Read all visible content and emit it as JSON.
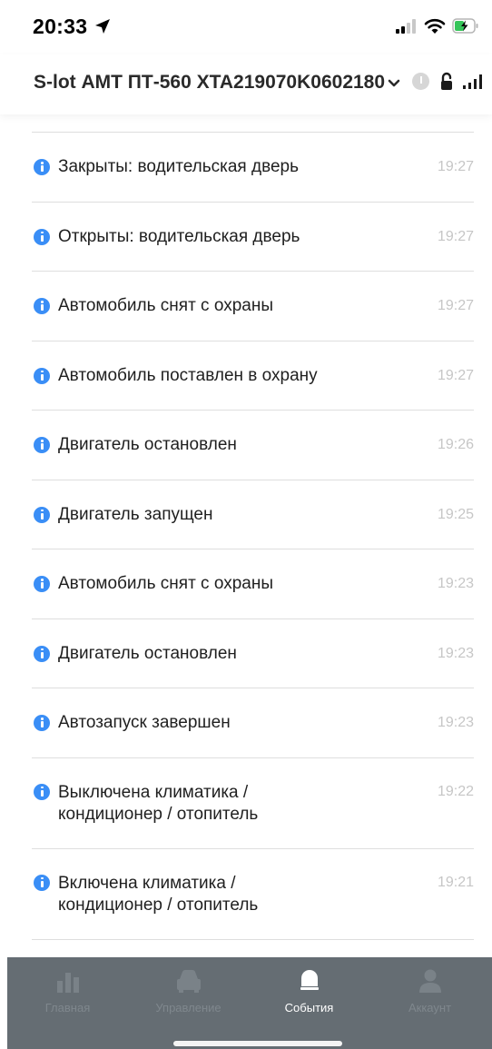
{
  "status_bar": {
    "time": "20:33",
    "icons": [
      "location-arrow-icon",
      "cellular-signal-icon",
      "wifi-icon",
      "battery-charging-icon"
    ]
  },
  "header": {
    "device_title": "S-lot АМТ ПТ-560 XTA219070K0602180",
    "icons": [
      "chevron-down-icon",
      "info-icon",
      "lock-open-icon",
      "signal-icon"
    ]
  },
  "events": [
    {
      "text": "Закрыты: водительская дверь",
      "time": "19:27"
    },
    {
      "text": "Открыты: водительская дверь",
      "time": "19:27"
    },
    {
      "text": "Автомобиль снят с охраны",
      "time": "19:27"
    },
    {
      "text": "Автомобиль поставлен в охрану",
      "time": "19:27"
    },
    {
      "text": "Двигатель остановлен",
      "time": "19:26"
    },
    {
      "text": "Двигатель запущен",
      "time": "19:25"
    },
    {
      "text": "Автомобиль снят с охраны",
      "time": "19:23"
    },
    {
      "text": "Двигатель остановлен",
      "time": "19:23"
    },
    {
      "text": "Автозапуск завершен",
      "time": "19:23"
    },
    {
      "text": "Выключена климатика / кондиционер / отопитель",
      "time": "19:22"
    },
    {
      "text": "Включена климатика / кондиционер / отопитель",
      "time": "19:21"
    }
  ],
  "tabbar": {
    "active_index": 2,
    "tabs": [
      {
        "label": "Главная",
        "icon": "bar-chart-icon"
      },
      {
        "label": "Управление",
        "icon": "car-icon"
      },
      {
        "label": "События",
        "icon": "bell-icon"
      },
      {
        "label": "Аккаунт",
        "icon": "user-icon"
      }
    ]
  },
  "colors": {
    "info_blue": "#3a8ef6",
    "tabbar_bg": "#656d73",
    "tab_inactive": "#7f878d",
    "tab_active": "#ffffff",
    "time_gray": "#c6c6c6"
  }
}
